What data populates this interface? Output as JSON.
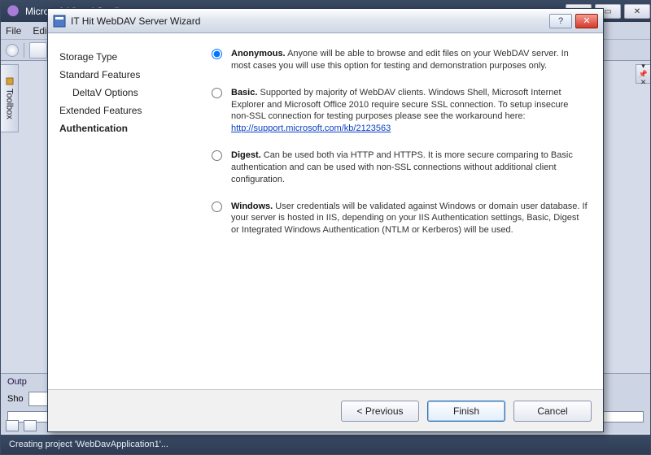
{
  "vs": {
    "title": "Microsoft Visual Studio",
    "menu": {
      "file": "File",
      "edit": "Edi"
    },
    "toolbox_label": "Toolbox",
    "output_title": "Outp",
    "show_label": "Sho",
    "status": "Creating project 'WebDavApplication1'..."
  },
  "dialog": {
    "title": "IT Hit WebDAV Server Wizard",
    "help_glyph": "?",
    "close_glyph": "✕",
    "steps": {
      "storage": "Storage Type",
      "standard": "Standard Features",
      "deltav": "DeltaV Options",
      "extended": "Extended Features",
      "auth": "Authentication"
    },
    "options": {
      "anonymous": {
        "name": "Anonymous.",
        "desc": " Anyone will be able to browse and edit files on your WebDAV server. In most cases you will use this option for testing and demonstration purposes only."
      },
      "basic": {
        "name": "Basic.",
        "desc": " Supported by majority of WebDAV clients. Windows Shell, Microsoft Internet Explorer and Microsoft Office 2010 require secure SSL connection. To setup insecure non-SSL connection for testing purposes please see the workaround here:",
        "link": "http://support.microsoft.com/kb/2123563"
      },
      "digest": {
        "name": "Digest.",
        "desc": " Can be used both via HTTP and HTTPS. It is more secure comparing to Basic authentication and can be used with non-SSL connections without additional client configuration."
      },
      "windows": {
        "name": "Windows.",
        "desc": " User credentials will be validated against Windows or domain user database. If your server is hosted in IIS, depending on your IIS Authentication settings, Basic, Digest or Integrated Windows Authentication (NTLM or Kerberos) will be used."
      }
    },
    "buttons": {
      "prev": "< Previous",
      "finish": "Finish",
      "cancel": "Cancel"
    }
  }
}
